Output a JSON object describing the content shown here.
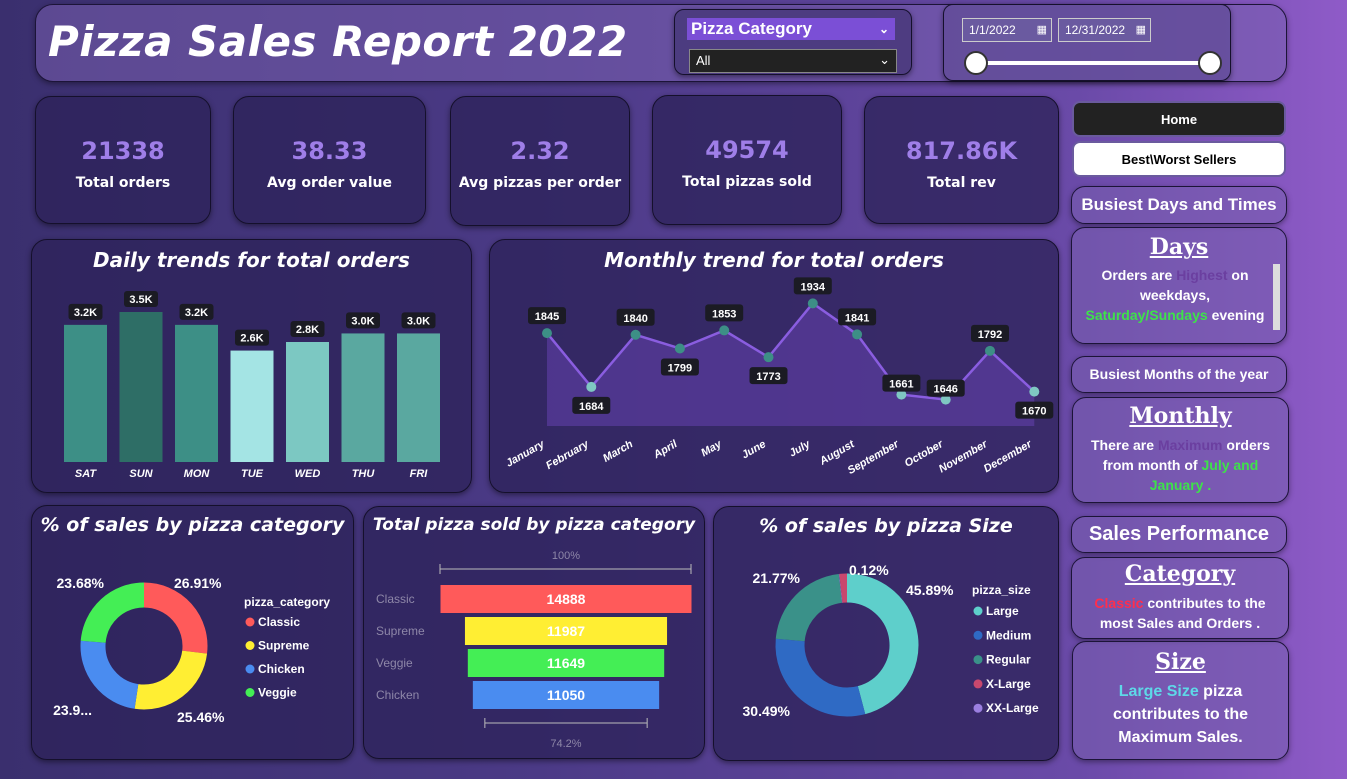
{
  "header": {
    "title": "Pizza Sales Report 2022",
    "filter_label": "Pizza Category",
    "filter_value": "All",
    "date_start": "1/1/2022",
    "date_end": "12/31/2022"
  },
  "kpis": [
    {
      "value": "21338",
      "label": "Total orders"
    },
    {
      "value": "38.33",
      "label": "Avg order value"
    },
    {
      "value": "2.32",
      "label": "Avg pizzas per order"
    },
    {
      "value": "49574",
      "label": "Total pizzas sold"
    },
    {
      "value": "817.86K",
      "label": "Total rev"
    }
  ],
  "nav": {
    "home": "Home",
    "best_worst": "Best\\Worst Sellers",
    "busiest": "Busiest Days and Times",
    "days_title": "Days",
    "days_text_1": "Orders are",
    "days_text_hl1": "Highest",
    "days_text_2": "on weekdays,",
    "days_text_hl2": "Saturday/Sundays",
    "days_text_3": "evening",
    "months_head": "Busiest Months of the year",
    "monthly_title": "Monthly",
    "monthly_text_1": "There are",
    "monthly_text_hl1": "Maximum",
    "monthly_text_2": "orders from month of",
    "monthly_text_hl2": "July and January .",
    "sales_perf": "Sales Performance",
    "category_title": "Category",
    "category_hl": "Classic",
    "category_text": "contributes to the most Sales and Orders .",
    "size_title": "Size",
    "size_hl": "Large Size",
    "size_text_1": "pizza",
    "size_text_2": "contributes to the Maximum Sales."
  },
  "colors": {
    "teal_dark": "#2e6e66",
    "teal": "#3d8f86",
    "teal_mid": "#5aa8a0",
    "teal_light": "#7cc8c2",
    "teal_pale": "#a4e4e4",
    "classic": "#ff5a5a",
    "supreme": "#ffee33",
    "chicken": "#4a8cf0",
    "veggie": "#44ee55",
    "size_large": "#5ecfcb",
    "size_medium": "#2f6ac4",
    "size_regular": "#3a9189",
    "size_xlarge": "#c8486e",
    "size_xxlarge": "#9b7fe0"
  },
  "chart_data": [
    {
      "type": "bar",
      "title": "Daily trends for total orders",
      "categories": [
        "SAT",
        "SUN",
        "MON",
        "TUE",
        "WED",
        "THU",
        "FRI"
      ],
      "values": [
        3200,
        3500,
        3200,
        2600,
        2800,
        3000,
        3000
      ],
      "data_labels": [
        "3.2K",
        "3.5K",
        "3.2K",
        "2.6K",
        "2.8K",
        "3.0K",
        "3.0K"
      ]
    },
    {
      "type": "area",
      "title": "Monthly trend for total orders",
      "categories": [
        "January",
        "February",
        "March",
        "April",
        "May",
        "June",
        "July",
        "August",
        "September",
        "October",
        "November",
        "December"
      ],
      "values": [
        1845,
        1684,
        1840,
        1799,
        1853,
        1773,
        1934,
        1841,
        1661,
        1646,
        1792,
        1670
      ]
    },
    {
      "type": "pie",
      "title": "% of sales by pizza category",
      "legend_title": "pizza_category",
      "categories": [
        "Classic",
        "Supreme",
        "Chicken",
        "Veggie"
      ],
      "values": [
        26.91,
        25.46,
        23.96,
        23.68
      ],
      "data_labels": [
        "26.91%",
        "25.46%",
        "23.9...",
        "23.68%"
      ]
    },
    {
      "type": "bar",
      "title": "Total pizza sold by pizza category",
      "categories": [
        "Classic",
        "Supreme",
        "Veggie",
        "Chicken"
      ],
      "values": [
        14888,
        11987,
        11649,
        11050
      ],
      "top_label": "100%",
      "bottom_label": "74.2%"
    },
    {
      "type": "pie",
      "title": "% of sales by pizza Size",
      "legend_title": "pizza_size",
      "categories": [
        "Large",
        "Medium",
        "Regular",
        "X-Large",
        "XX-Large"
      ],
      "values": [
        45.89,
        30.49,
        21.77,
        1.72,
        0.12
      ],
      "data_labels": [
        "45.89%",
        "30.49%",
        "21.77%",
        "",
        "0.12%"
      ]
    }
  ]
}
